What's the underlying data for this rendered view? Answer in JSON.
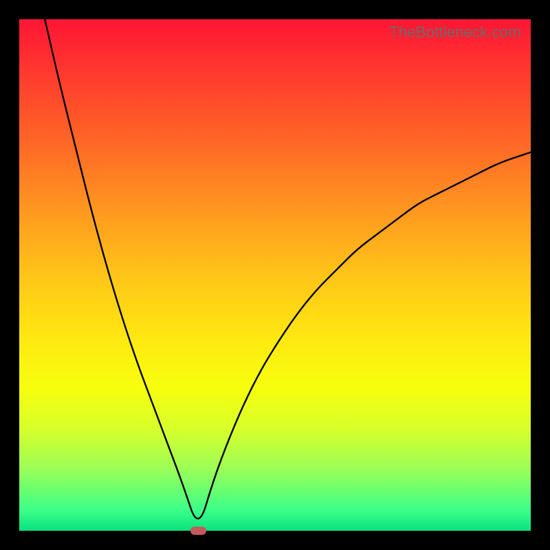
{
  "watermark": "TheBottleneck.com",
  "colors": {
    "gradient_top": "#ff1534",
    "gradient_bottom": "#09e27e",
    "curve": "#000000",
    "marker": "#c35a5c",
    "frame": "#000000"
  },
  "chart_data": {
    "type": "line",
    "title": "",
    "xlabel": "",
    "ylabel": "",
    "xlim": [
      0,
      100
    ],
    "ylim": [
      0,
      100
    ],
    "notes": "V-shaped bottleneck curve on vertical rainbow gradient (red high → green low). Minimum at x≈35, y≈0. Left branch rises to y=100 at x≈5. Right branch rises to y≈74 at x=100.",
    "series": [
      {
        "name": "bottleneck",
        "x": [
          5,
          8,
          11,
          14,
          17,
          20,
          23,
          26,
          29,
          32,
          35,
          38,
          41,
          44,
          47,
          50,
          54,
          58,
          62,
          66,
          70,
          74,
          78,
          82,
          86,
          90,
          94,
          100
        ],
        "values": [
          100,
          87,
          75,
          63,
          52,
          42,
          33,
          25,
          17,
          9,
          0,
          10,
          18,
          25,
          31,
          36,
          42,
          47,
          51,
          55,
          58,
          61,
          64,
          66,
          68,
          70,
          72,
          74
        ]
      }
    ],
    "marker": {
      "x": 35,
      "y": 0,
      "width_x_units": 3.2,
      "height_y_units": 1.6
    }
  }
}
